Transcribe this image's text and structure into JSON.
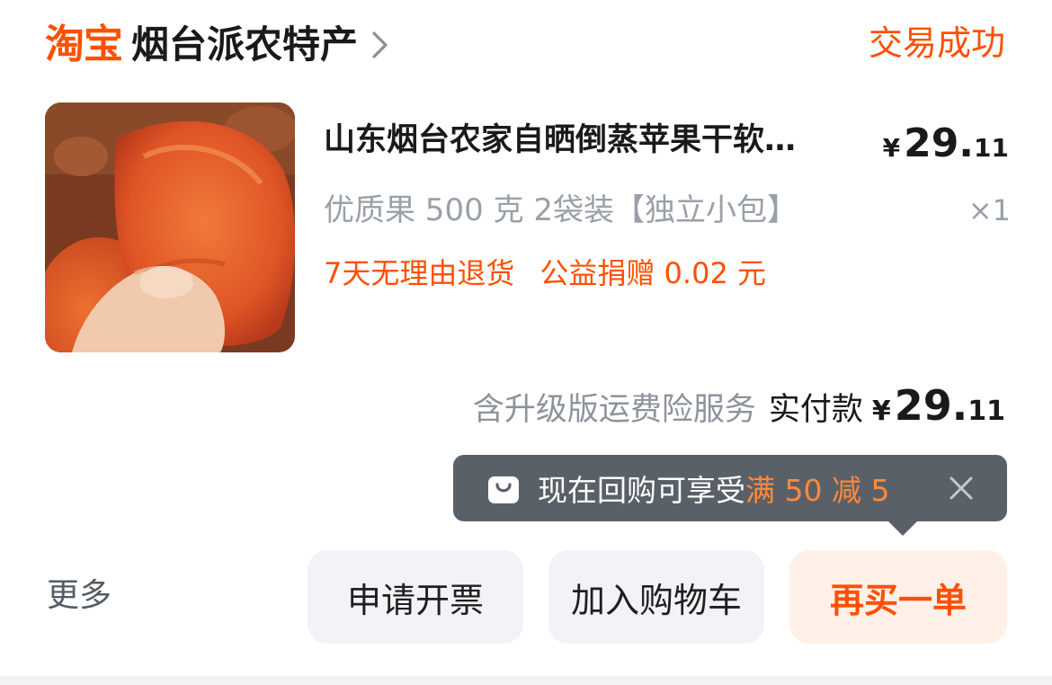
{
  "header": {
    "brand": "淘宝",
    "shop_name": "烟台派农特产",
    "status": "交易成功"
  },
  "product": {
    "title": "山东烟台农家自晒倒蒸苹果干软…",
    "price_currency": "¥",
    "price_int": "29.",
    "price_dec": "11",
    "sku": "优质果 500 克 2袋装【独立小包】",
    "quantity": "×1",
    "tags": [
      "7天无理由退货",
      "公益捐赠 0.02 元"
    ]
  },
  "total": {
    "insurance_note": "含升级版运费险服务",
    "paid_label": "实付款",
    "currency": "¥",
    "int": "29.",
    "dec": "11"
  },
  "tooltip": {
    "text": "现在回购可享受",
    "highlight": "满 50 减 5"
  },
  "footer": {
    "more": "更多",
    "invoice": "申请开票",
    "add_to_cart": "加入购物车",
    "buy_again": "再买一单"
  },
  "colors": {
    "accent": "#ff5000",
    "tooltip_bg": "#5a6068",
    "tooltip_highlight": "#ff8a3a",
    "muted_text": "#9aa0a8"
  },
  "icons": {
    "header_chevron": "chevron-right-icon",
    "tooltip_icon": "shopping-bag-icon",
    "tooltip_close": "close-icon"
  }
}
